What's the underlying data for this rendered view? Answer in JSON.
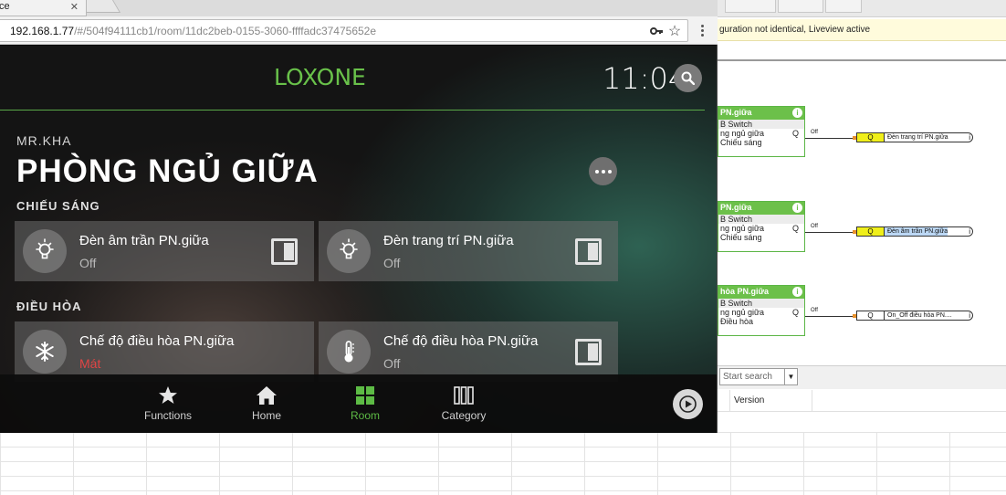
{
  "browser": {
    "tab_fragment": "ce",
    "url_host": "192.168.1.77",
    "url_path": "/#/504f94111cb1/room/11dc2beb-0155-3060-ffffadc37475652e"
  },
  "background_app": {
    "notice": "guration not identical, Liveview active",
    "blocks": [
      {
        "title": "PN.giữa",
        "rows": [
          "B Switch",
          "ng ngủ giữa",
          "Chiếu sáng"
        ],
        "q": "Q",
        "wire": "Off",
        "output_q": "Q",
        "output_label": "Đèn trang trí PN.giữa",
        "output_color": "#f0ef1a"
      },
      {
        "title": "PN.giữa",
        "rows": [
          "B Switch",
          "ng ngủ giữa",
          "Chiếu sáng"
        ],
        "q": "Q",
        "wire": "Off",
        "output_q": "Q",
        "output_label": "Đèn âm trần PN.giữa",
        "output_color": "#f0ef1a",
        "label_color": "#bcd8f5"
      },
      {
        "title": "hòa PN.giữa",
        "rows": [
          "B Switch",
          "ng ngủ giữa",
          "Điều hòa"
        ],
        "q": "Q",
        "wire": "Off",
        "output_q": "Q",
        "output_label": "On_Off điều hòa PN....",
        "output_color": "#ffffff"
      }
    ],
    "search_placeholder": "Start search",
    "column_version": "Version"
  },
  "app": {
    "brand": "LOXONE",
    "time": "11:04",
    "owner": "MR.KHA",
    "room_title": "PHÒNG NGỦ GIỮA",
    "categories": [
      {
        "name": "CHIẾU SÁNG",
        "cards": [
          {
            "title": "Đèn âm trần PN.giữa",
            "state": "Off",
            "icon": "lightbulb-icon"
          },
          {
            "title": "Đèn trang trí PN.giữa",
            "state": "Off",
            "icon": "lightbulb-icon"
          }
        ]
      },
      {
        "name": "ĐIỀU HÒA",
        "cards": [
          {
            "title": "Chế độ điều hòa PN.giữa",
            "state": "Mát",
            "icon": "snowflake-icon",
            "state_color": "#e04545"
          },
          {
            "title": "Chế độ điều hòa PN.giữa",
            "state": "Off",
            "icon": "thermometer-icon"
          }
        ]
      }
    ],
    "nav": [
      {
        "label": "Functions",
        "icon": "star-icon"
      },
      {
        "label": "Home",
        "icon": "home-icon"
      },
      {
        "label": "Room",
        "icon": "grid-icon",
        "active": true
      },
      {
        "label": "Category",
        "icon": "category-icon"
      }
    ],
    "accent_color": "#69c14a"
  }
}
